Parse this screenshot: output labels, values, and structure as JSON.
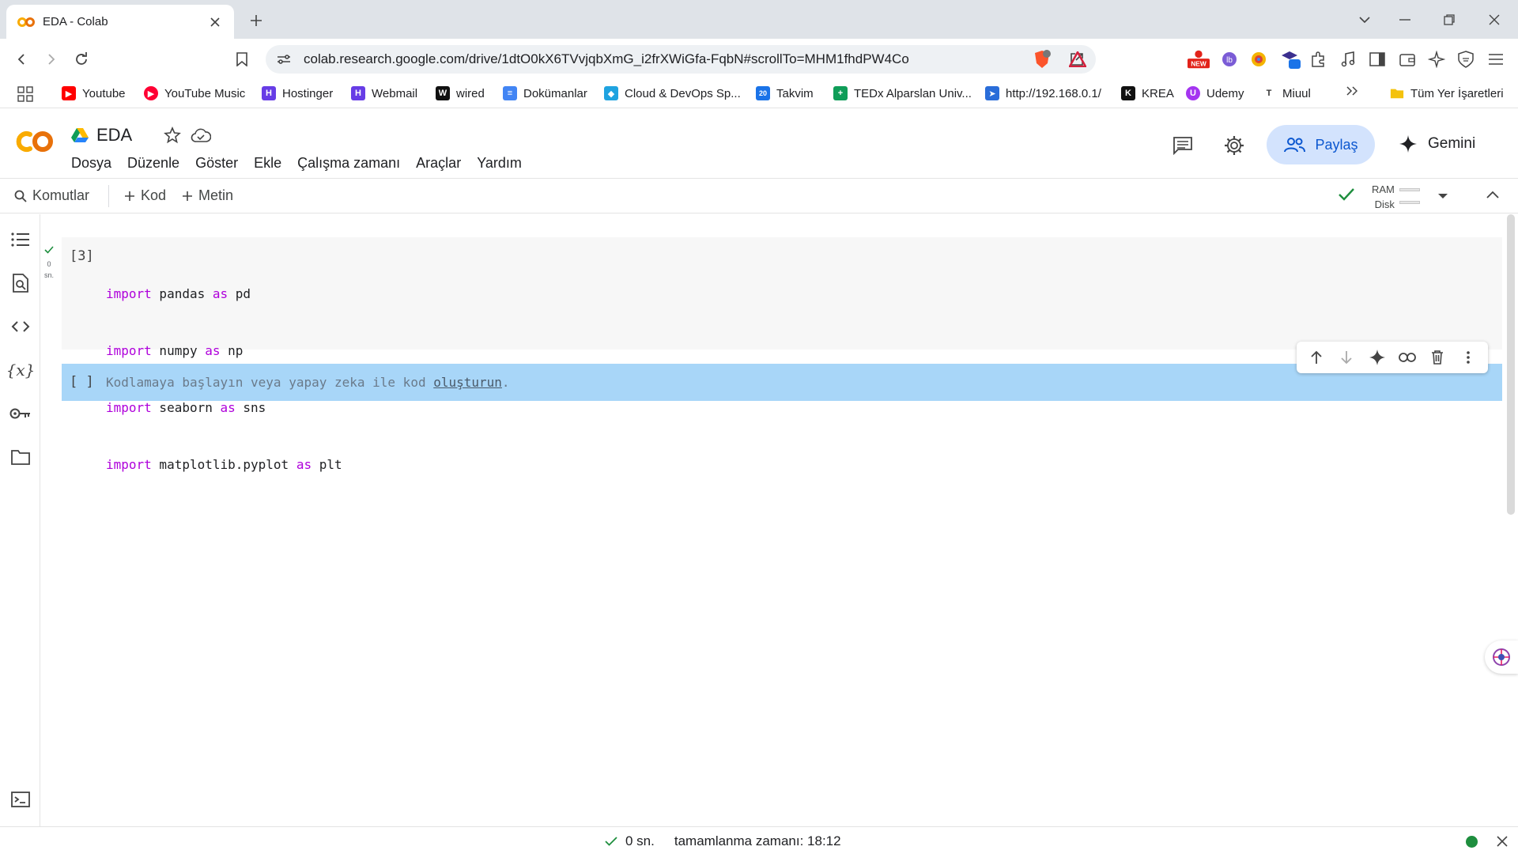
{
  "browser": {
    "tab_title": "EDA - Colab",
    "url": "colab.research.google.com/drive/1dtO0kX6TVvjqbXmG_i2frXWiGfa-FqbN#scrollTo=MHM1fhdPW4Co",
    "badges": {
      "brave_count": "2",
      "ext_new": "NEW",
      "ext_count": "14"
    },
    "bookmarks": [
      {
        "label": "Youtube",
        "icon": "youtube-icon",
        "color": "#ff0000"
      },
      {
        "label": "YouTube Music",
        "icon": "youtube-music-icon",
        "color": "#ff0033"
      },
      {
        "label": "Hostinger",
        "icon": "hostinger-icon",
        "color": "#673de6"
      },
      {
        "label": "Webmail",
        "icon": "webmail-icon",
        "color": "#673de6"
      },
      {
        "label": "wired",
        "icon": "wired-icon",
        "color": "#111111"
      },
      {
        "label": "Dokümanlar",
        "icon": "docs-icon",
        "color": "#4285f4"
      },
      {
        "label": "Cloud & DevOps Sp...",
        "icon": "cloud-icon",
        "color": "#1fa3e0"
      },
      {
        "label": "Takvim",
        "icon": "calendar-icon",
        "color": "#1a73e8"
      },
      {
        "label": "TEDx Alparslan Univ...",
        "icon": "sheets-icon",
        "color": "#0f9d58"
      },
      {
        "label": "http://192.168.0.1/",
        "icon": "router-icon",
        "color": "#2a6dd9"
      },
      {
        "label": "KREA",
        "icon": "krea-icon",
        "color": "#111111"
      },
      {
        "label": "Udemy",
        "icon": "udemy-icon",
        "color": "#a435f0"
      },
      {
        "label": "Miuul",
        "icon": "miuul-icon",
        "color": "#333333"
      }
    ],
    "all_bookmarks": "Tüm Yer İşaretleri"
  },
  "colab": {
    "notebook_title": "EDA",
    "menu": [
      "Dosya",
      "Düzenle",
      "Göster",
      "Ekle",
      "Çalışma zamanı",
      "Araçlar",
      "Yardım"
    ],
    "share_label": "Paylaş",
    "gemini_label": "Gemini",
    "toolbar": {
      "commands": "Komutlar",
      "add_code": "Kod",
      "add_text": "Metin",
      "ram_label": "RAM",
      "disk_label": "Disk"
    },
    "cells": {
      "cell1": {
        "exec_count": "[3]",
        "run_time": "0",
        "run_unit": "sn.",
        "lines": [
          {
            "kw1": "import",
            "mod": " pandas ",
            "kw2": "as",
            "alias": " pd"
          },
          {
            "kw1": "import",
            "mod": " numpy ",
            "kw2": "as",
            "alias": " np"
          },
          {
            "kw1": "import",
            "mod": " seaborn ",
            "kw2": "as",
            "alias": " sns"
          },
          {
            "kw1": "import",
            "mod": " matplotlib.pyplot ",
            "kw2": "as",
            "alias": " plt"
          }
        ]
      },
      "cell2": {
        "brackets": "[ ]",
        "placeholder_prefix": "Kodlamaya başlayın veya yapay zeka ile kod ",
        "placeholder_link": "oluşturun",
        "placeholder_suffix": "."
      }
    },
    "status": {
      "duration": "0 sn.",
      "completed": "tamamlanma zamanı: 18:12"
    }
  },
  "colors": {
    "accent": "#0b57d0",
    "share_bg": "#d3e3fd",
    "selected_cell": "#a8d6f8",
    "keyword": "#af00db",
    "ok_green": "#1e8e3e"
  }
}
